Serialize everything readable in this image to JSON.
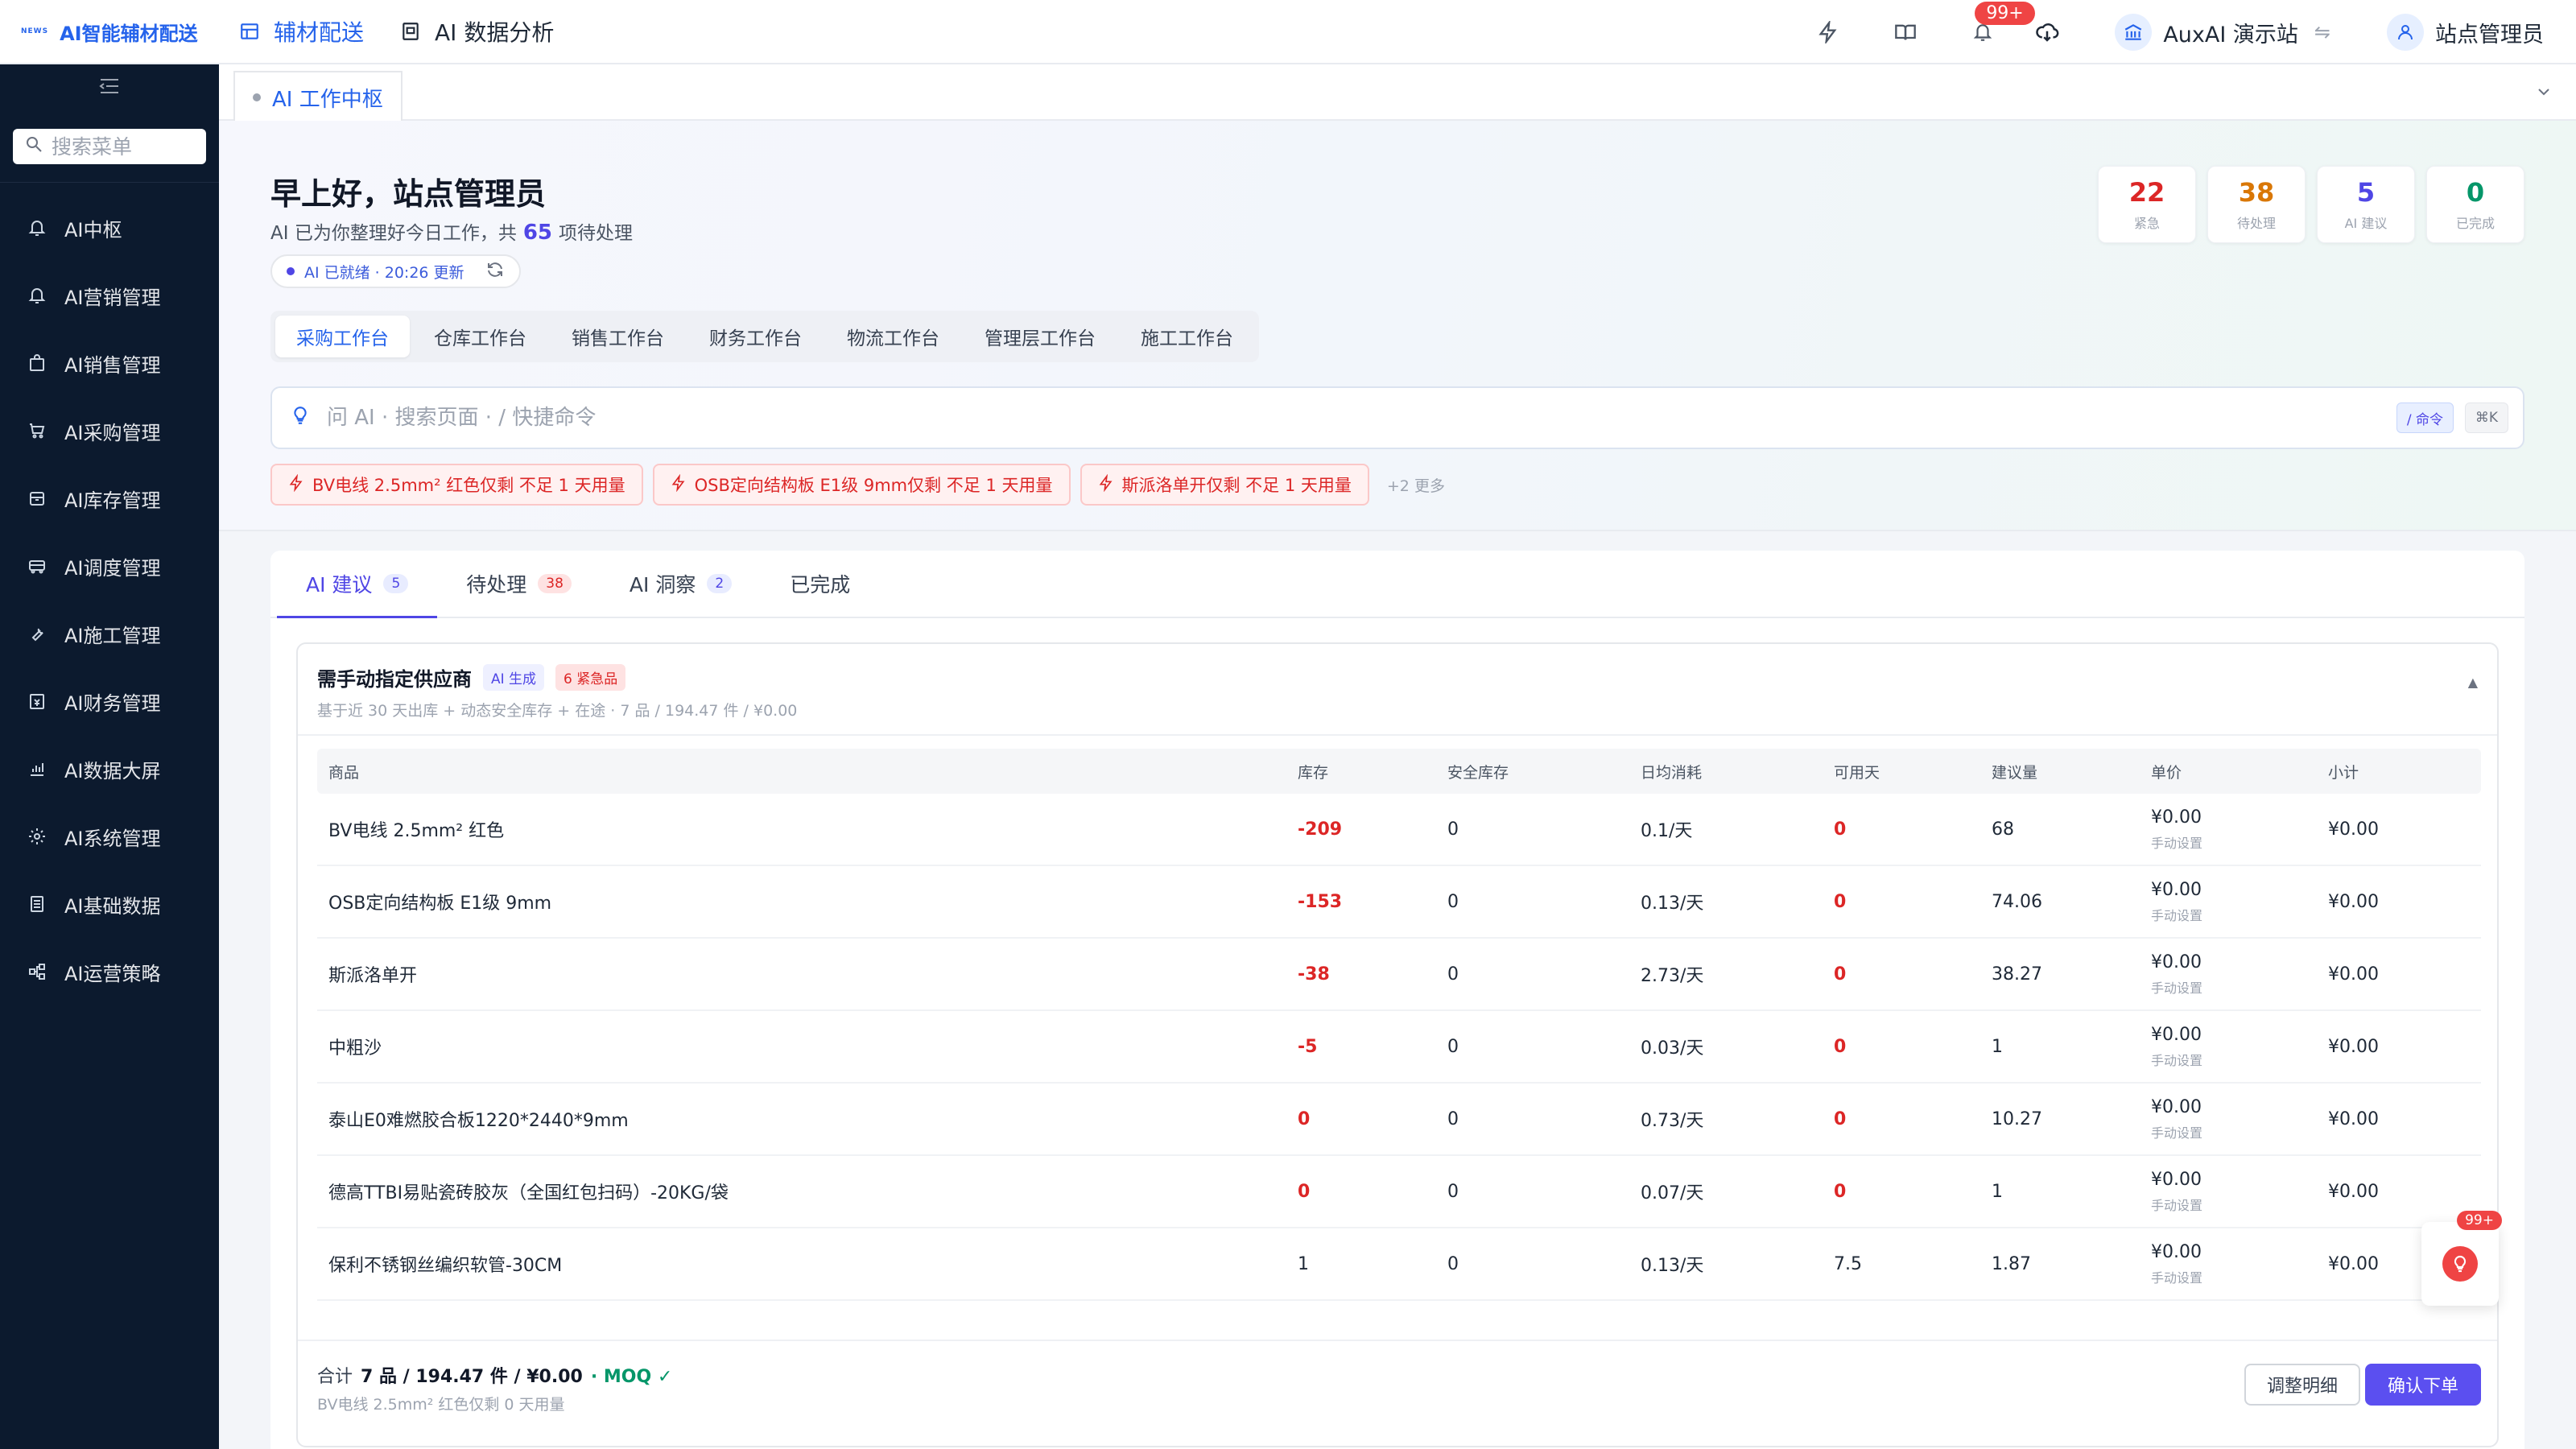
{
  "brand": {
    "badge": "NEWS",
    "name": "AI智能辅材配送"
  },
  "topnav": [
    {
      "label": "辅材配送",
      "active": true
    },
    {
      "label": "AI 数据分析",
      "active": false
    }
  ],
  "header": {
    "notification_badge": "99+",
    "site_name": "AuxAI 演示站",
    "swap_symbol": "⇋",
    "user_name": "站点管理员"
  },
  "sidebar": {
    "search_placeholder": "搜索菜单",
    "items": [
      {
        "label": "AI中枢",
        "icon": "bell-icon"
      },
      {
        "label": "AI营销管理",
        "icon": "bell-icon"
      },
      {
        "label": "AI销售管理",
        "icon": "bag-icon"
      },
      {
        "label": "AI采购管理",
        "icon": "cart-icon"
      },
      {
        "label": "AI库存管理",
        "icon": "box-icon"
      },
      {
        "label": "AI调度管理",
        "icon": "truck-icon"
      },
      {
        "label": "AI施工管理",
        "icon": "wrench-icon"
      },
      {
        "label": "AI财务管理",
        "icon": "finance-icon"
      },
      {
        "label": "AI数据大屏",
        "icon": "chart-icon"
      },
      {
        "label": "AI系统管理",
        "icon": "gear-icon"
      },
      {
        "label": "AI基础数据",
        "icon": "list-icon"
      },
      {
        "label": "AI运营策略",
        "icon": "network-icon"
      }
    ]
  },
  "page_tab": {
    "label": "AI 工作中枢"
  },
  "hero": {
    "greeting": "早上好，站点管理员",
    "sub_prefix": "AI 已为你整理好今日工作，共",
    "sub_count": "65",
    "sub_suffix": "项待处理",
    "status_pill": "AI 已就绪 · 20:26 更新",
    "stats": [
      {
        "value": "22",
        "label": "紧急",
        "color": "#dc2626"
      },
      {
        "value": "38",
        "label": "待处理",
        "color": "#d97706"
      },
      {
        "value": "5",
        "label": "AI 建议",
        "color": "#4f46e5"
      },
      {
        "value": "0",
        "label": "已完成",
        "color": "#059669"
      }
    ],
    "workspace_tabs": [
      {
        "label": "采购工作台",
        "active": true
      },
      {
        "label": "仓库工作台",
        "active": false
      },
      {
        "label": "销售工作台",
        "active": false
      },
      {
        "label": "财务工作台",
        "active": false
      },
      {
        "label": "物流工作台",
        "active": false
      },
      {
        "label": "管理层工作台",
        "active": false
      },
      {
        "label": "施工工作台",
        "active": false
      }
    ],
    "ask_placeholder": "问 AI · 搜索页面 · / 快捷命令",
    "ask_cmd": "/ 命令",
    "ask_shortcut": "⌘K",
    "alerts": [
      "BV电线 2.5mm² 红色仅剩 不足 1 天用量",
      "OSB定向结构板 E1级 9mm仅剩 不足 1 天用量",
      "斯派洛单开仅剩 不足 1 天用量"
    ],
    "alerts_more": "+2 更多"
  },
  "panel": {
    "tabs": [
      {
        "label": "AI 建议",
        "count": "5",
        "count_style": "blue",
        "active": true
      },
      {
        "label": "待处理",
        "count": "38",
        "count_style": "red",
        "active": false
      },
      {
        "label": "AI 洞察",
        "count": "2",
        "count_style": "blue",
        "active": false
      },
      {
        "label": "已完成",
        "count": "",
        "count_style": "",
        "active": false
      }
    ],
    "card": {
      "title": "需手动指定供应商",
      "tag_ai": "AI 生成",
      "tag_urgent": "6 紧急品",
      "subtitle": "基于近 30 天出库 + 动态安全库存 + 在途 · 7 品 / 194.47 件 / ¥0.00",
      "caret": "▲",
      "columns": [
        "商品",
        "库存",
        "安全库存",
        "日均消耗",
        "可用天",
        "建议量",
        "单价",
        "小计"
      ],
      "rows": [
        {
          "name": "BV电线 2.5mm² 红色",
          "stock": "-209",
          "safety": "0",
          "daily": "0.1/天",
          "days": "0",
          "suggest": "68",
          "price": "¥0.00",
          "price_note": "手动设置",
          "subtotal": "¥0.00",
          "stock_alert": true,
          "days_alert": true
        },
        {
          "name": "OSB定向结构板 E1级 9mm",
          "stock": "-153",
          "safety": "0",
          "daily": "0.13/天",
          "days": "0",
          "suggest": "74.06",
          "price": "¥0.00",
          "price_note": "手动设置",
          "subtotal": "¥0.00",
          "stock_alert": true,
          "days_alert": true
        },
        {
          "name": "斯派洛单开",
          "stock": "-38",
          "safety": "0",
          "daily": "2.73/天",
          "days": "0",
          "suggest": "38.27",
          "price": "¥0.00",
          "price_note": "手动设置",
          "subtotal": "¥0.00",
          "stock_alert": true,
          "days_alert": true
        },
        {
          "name": "中粗沙",
          "stock": "-5",
          "safety": "0",
          "daily": "0.03/天",
          "days": "0",
          "suggest": "1",
          "price": "¥0.00",
          "price_note": "手动设置",
          "subtotal": "¥0.00",
          "stock_alert": true,
          "days_alert": true
        },
        {
          "name": "泰山E0难燃胶合板1220*2440*9mm",
          "stock": "0",
          "safety": "0",
          "daily": "0.73/天",
          "days": "0",
          "suggest": "10.27",
          "price": "¥0.00",
          "price_note": "手动设置",
          "subtotal": "¥0.00",
          "stock_alert": true,
          "days_alert": true
        },
        {
          "name": "德高TTBI易贴瓷砖胶灰（全国红包扫码）-20KG/袋",
          "stock": "0",
          "safety": "0",
          "daily": "0.07/天",
          "days": "0",
          "suggest": "1",
          "price": "¥0.00",
          "price_note": "手动设置",
          "subtotal": "¥0.00",
          "stock_alert": true,
          "days_alert": true
        },
        {
          "name": "保利不锈钢丝编织软管-30CM",
          "stock": "1",
          "safety": "0",
          "daily": "0.13/天",
          "days": "7.5",
          "suggest": "1.87",
          "price": "¥0.00",
          "price_note": "手动设置",
          "subtotal": "¥0.00",
          "stock_alert": false,
          "days_alert": false
        }
      ],
      "footer_prefix": "合计",
      "footer_total": "7 品 / 194.47 件 / ¥0.00",
      "footer_moq": "· MOQ ✓",
      "footer_sub": "BV电线 2.5mm² 红色仅剩 0 天用量",
      "btn_adjust": "调整明细",
      "btn_confirm": "确认下单"
    }
  },
  "fab": {
    "badge": "99+"
  }
}
